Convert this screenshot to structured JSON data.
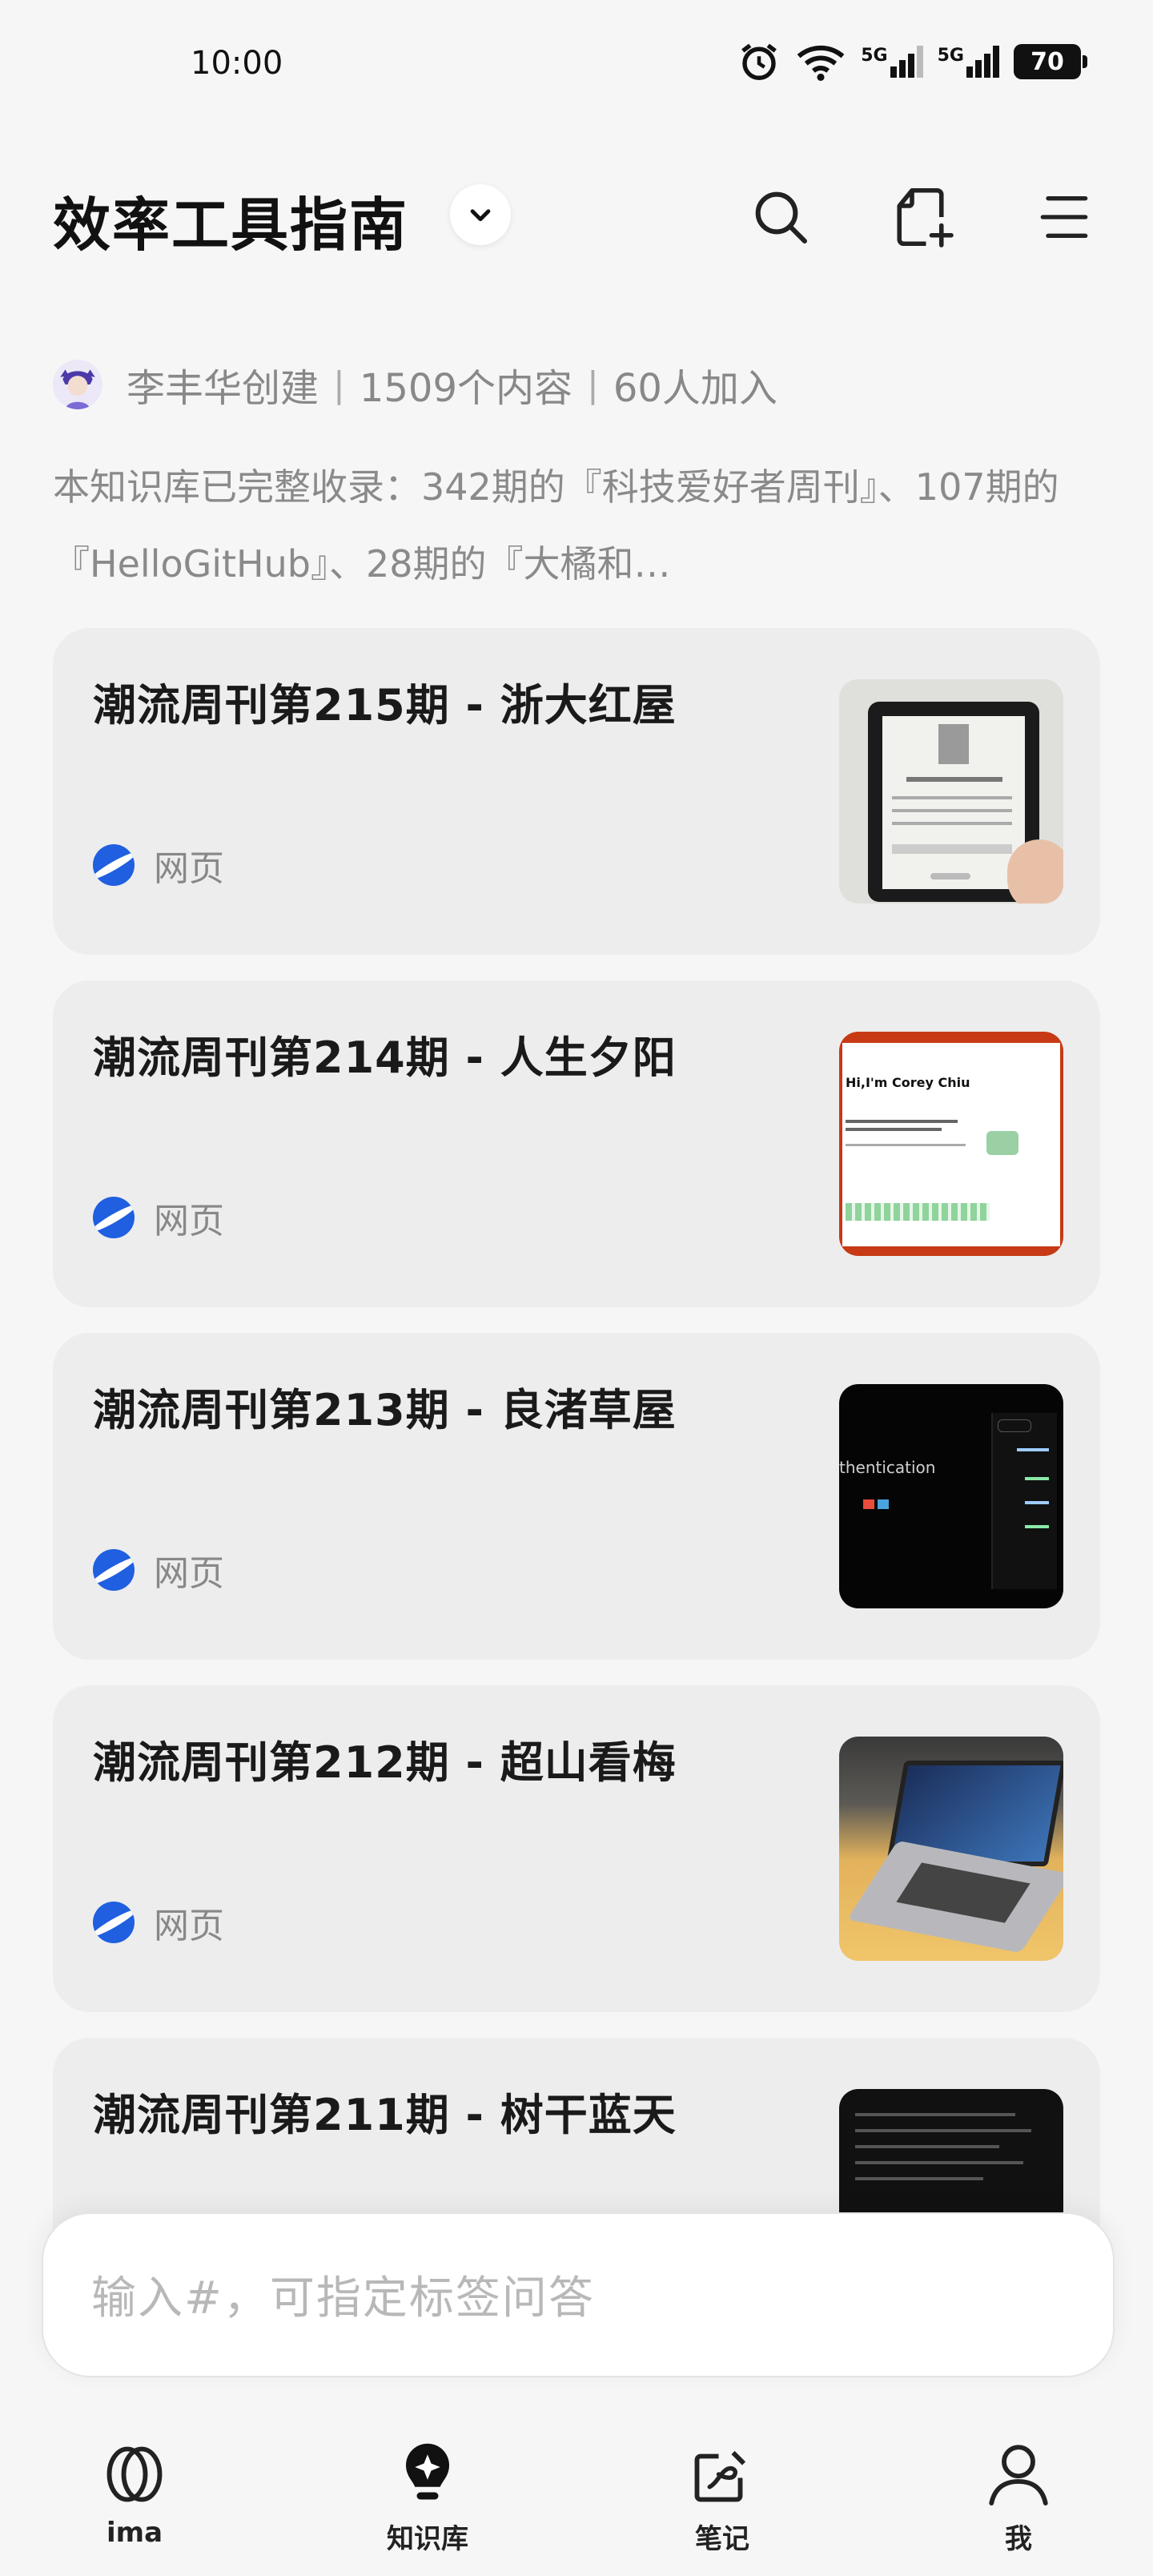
{
  "status_bar": {
    "time": "10:00",
    "network_1": "5G",
    "network_2": "5G",
    "battery": "70"
  },
  "header": {
    "title": "效率工具指南"
  },
  "meta": {
    "creator": "李丰华创建",
    "content_count": "1509个内容",
    "members": "60人加入"
  },
  "description": "本知识库已完整收录：342期的『科技爱好者周刊』、107期的『HelloGitHub』、28期的『大橘和…",
  "cards": [
    {
      "title": "潮流周刊第215期 - 浙大红屋",
      "tag": "网页"
    },
    {
      "title": "潮流周刊第214期 - 人生夕阳",
      "tag": "网页",
      "thumb_text": "Hi,I'm Corey Chiu"
    },
    {
      "title": "潮流周刊第213期 - 良渚草屋",
      "tag": "网页",
      "thumb_text": "thentication"
    },
    {
      "title": "潮流周刊第212期 - 超山看梅",
      "tag": "网页"
    },
    {
      "title": "潮流周刊第211期 - 树干蓝天",
      "tag": "网页"
    }
  ],
  "input": {
    "placeholder": "输入#，可指定标签问答"
  },
  "tabs": [
    {
      "label": "ima",
      "icon": "ima-logo-icon"
    },
    {
      "label": "知识库",
      "icon": "knowledge-base-icon"
    },
    {
      "label": "笔记",
      "icon": "note-icon"
    },
    {
      "label": "我",
      "icon": "profile-icon"
    }
  ],
  "colors": {
    "background": "#f6f6f7",
    "card": "#ededee",
    "accent": "#1f5fe0",
    "text": "#111111"
  }
}
